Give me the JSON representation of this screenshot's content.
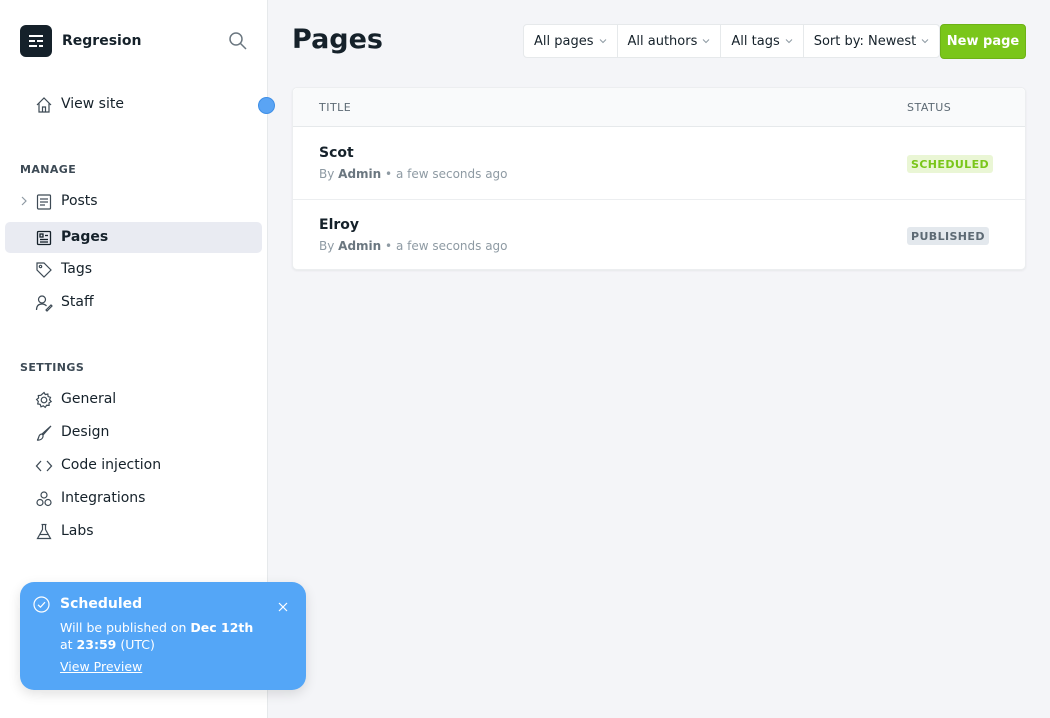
{
  "brand": {
    "name": "Regresion"
  },
  "sidebar": {
    "view_site": "View site",
    "manage_title": "MANAGE",
    "manage_items": [
      {
        "label": "Posts",
        "icon": "posts-icon"
      },
      {
        "label": "Pages",
        "icon": "pages-icon",
        "active": true
      },
      {
        "label": "Tags",
        "icon": "tag-icon"
      },
      {
        "label": "Staff",
        "icon": "staff-icon"
      }
    ],
    "settings_title": "SETTINGS",
    "settings_items": [
      {
        "label": "General",
        "icon": "gear-icon"
      },
      {
        "label": "Design",
        "icon": "brush-icon"
      },
      {
        "label": "Code injection",
        "icon": "code-icon"
      },
      {
        "label": "Integrations",
        "icon": "integrations-icon"
      },
      {
        "label": "Labs",
        "icon": "flask-icon"
      }
    ]
  },
  "main": {
    "title": "Pages",
    "filters": [
      "All pages",
      "All authors",
      "All tags",
      "Sort by: Newest"
    ],
    "new_button": "New page",
    "table": {
      "headers": {
        "title": "TITLE",
        "status": "STATUS"
      },
      "rows": [
        {
          "title": "Scot",
          "by": "By",
          "author": "Admin",
          "time": "• a few seconds ago",
          "status": "SCHEDULED"
        },
        {
          "title": "Elroy",
          "by": "By",
          "author": "Admin",
          "time": "• a few seconds ago",
          "status": "PUBLISHED"
        }
      ]
    }
  },
  "toast": {
    "title": "Scheduled",
    "msg_prefix": "Will be published on",
    "msg_date": "Dec 12th",
    "msg_at": "at",
    "msg_time": "23:59",
    "msg_tz": "(UTC)",
    "link": "View Preview"
  },
  "colors": {
    "accent_green": "#7ac61a",
    "toast_blue": "#54a6f7",
    "sidebar_active": "#e9ebf2"
  }
}
